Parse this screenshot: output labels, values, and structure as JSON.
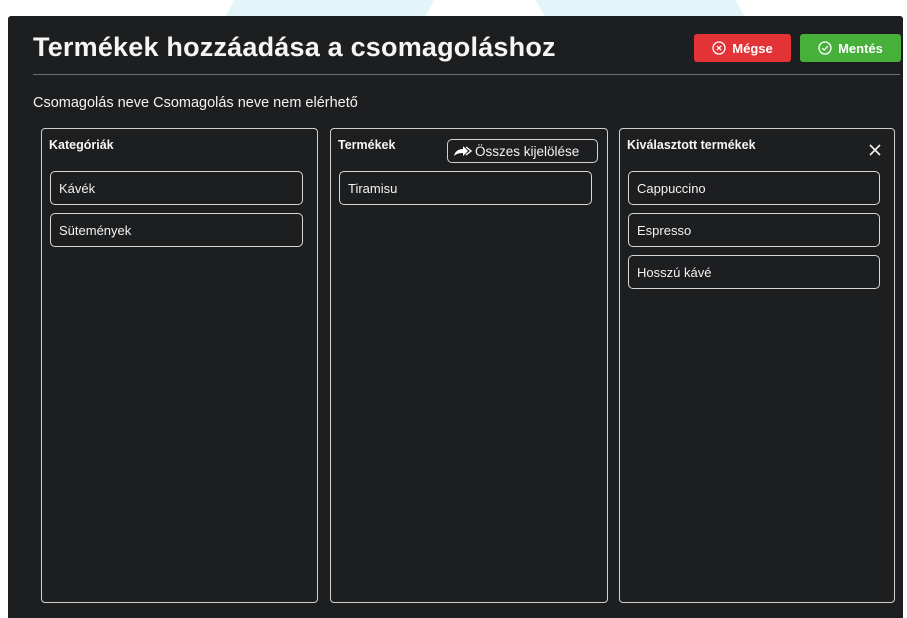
{
  "header": {
    "title": "Termékek hozzáadása a csomagoláshoz",
    "cancel_label": "Mégse",
    "save_label": "Mentés"
  },
  "subline": "Csomagolás neve Csomagolás neve nem elérhető",
  "categories": {
    "title": "Kategóriák",
    "items": [
      "Kávék",
      "Sütemények"
    ]
  },
  "products": {
    "title": "Termékek",
    "select_all_label": "Összes kijelölése",
    "items": [
      "Tiramisu"
    ]
  },
  "selected": {
    "title": "Kiválasztott termékek",
    "items": [
      "Cappuccino",
      "Espresso",
      "Hosszú kávé"
    ]
  },
  "colors": {
    "panel_bg": "#1d1e20",
    "cancel": "#e43337",
    "save": "#46b03b",
    "page_bg_shape": "#e3f5fb"
  },
  "icons": {
    "cancel": "circle-x-icon",
    "save": "circle-check-icon",
    "select_all": "share-arrow-icon",
    "close": "close-icon"
  }
}
